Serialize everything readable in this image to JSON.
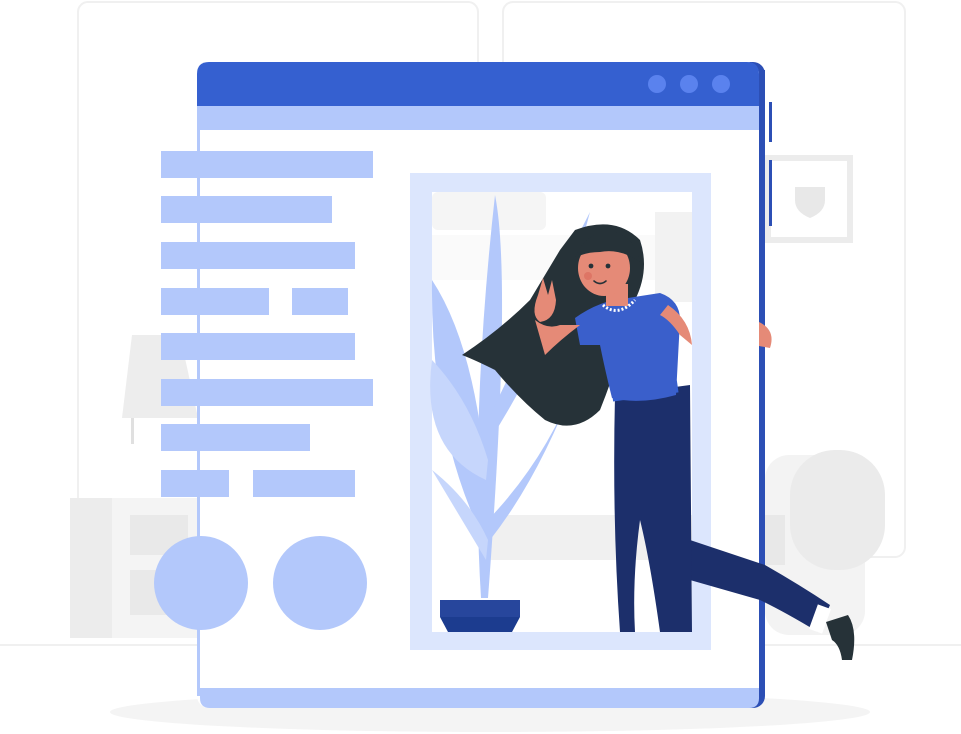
{
  "illustration": {
    "subject": "woman-leaning-out-of-browser-window",
    "colors": {
      "window_blue": "#3560D0",
      "window_blue_dark": "#2C4FB5",
      "accent_light": "#B3C8FB",
      "accent_lighter": "#DCE6FD",
      "shirt_blue": "#3A5FCB",
      "pants_navy": "#1C2F6B",
      "hair": "#263238",
      "skin": "#E58A77",
      "background_gray": "#F4F4F4"
    },
    "window_controls": [
      {
        "name": "control-dot-1"
      },
      {
        "name": "control-dot-2"
      },
      {
        "name": "control-dot-3"
      }
    ],
    "text_placeholder_rows": [
      {
        "segments": 1,
        "fill": 1.0
      },
      {
        "segments": 1,
        "fill": 0.8
      },
      {
        "segments": 1,
        "fill": 0.92
      },
      {
        "segments": 2,
        "fill": 0.88
      },
      {
        "segments": 1,
        "fill": 0.92
      },
      {
        "segments": 1,
        "fill": 1.0
      },
      {
        "segments": 1,
        "fill": 0.7
      },
      {
        "segments": 2,
        "fill": 0.92
      }
    ],
    "circle_buttons": 2
  }
}
